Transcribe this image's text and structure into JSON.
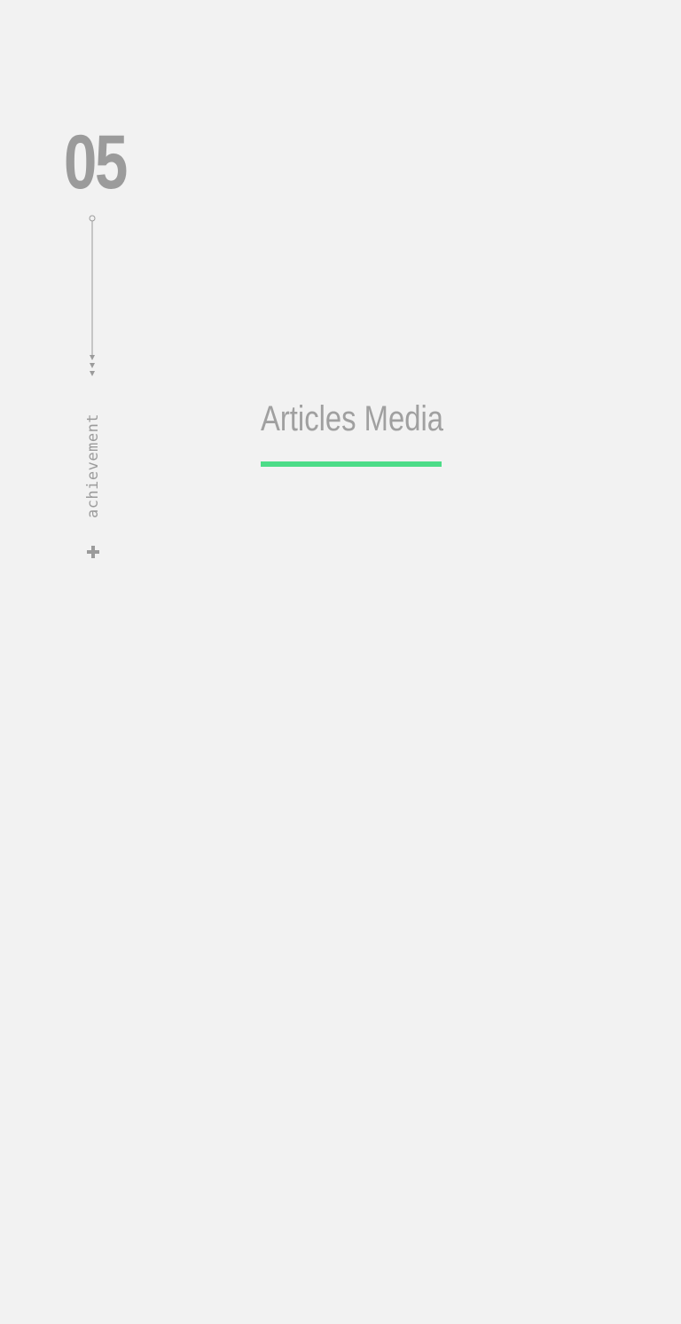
{
  "section": {
    "number": "05",
    "label": "achievement"
  },
  "tabs": [
    {
      "label": "Articles Media",
      "active": true
    }
  ],
  "icons": {
    "timeline": "timeline-line-icon",
    "expand": "plus-icon"
  },
  "colors": {
    "background": "#f2f2f2",
    "text_muted": "#9b9b9b",
    "accent": "#4cdc88"
  }
}
